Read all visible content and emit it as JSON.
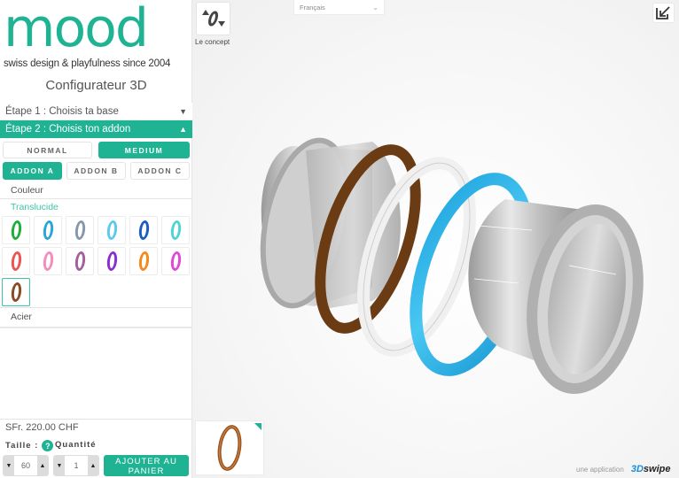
{
  "brand": {
    "logo_text": "mood",
    "tagline": "swiss design & playfulness since 2004",
    "title": "Configurateur 3D",
    "accent_color": "#1fb393"
  },
  "steps": [
    {
      "label": "Étape 1 : Choisis ta base",
      "icon": "chevron-down-icon",
      "expanded": false
    },
    {
      "label": "Étape 2 : Choisis ton addon",
      "icon": "chevron-up-icon",
      "expanded": true
    }
  ],
  "width_options": [
    {
      "label": "NORMAL",
      "selected": false
    },
    {
      "label": "MEDIUM",
      "selected": true
    }
  ],
  "addon_tabs": [
    {
      "label": "ADDON A",
      "selected": true
    },
    {
      "label": "ADDON B",
      "selected": false
    },
    {
      "label": "ADDON C",
      "selected": false
    }
  ],
  "sections": {
    "color_label": "Couleur",
    "translucent_label": "Translucide",
    "steel_label": "Acier"
  },
  "swatches": [
    {
      "name": "green",
      "color": "#1cb03a",
      "selected": false
    },
    {
      "name": "sky-blue",
      "color": "#2aa6d6",
      "selected": false
    },
    {
      "name": "grey-blue",
      "color": "#8797ab",
      "selected": false
    },
    {
      "name": "light-blue",
      "color": "#5cc9ef",
      "selected": false
    },
    {
      "name": "dark-blue",
      "color": "#1a5fbf",
      "selected": false
    },
    {
      "name": "turquoise",
      "color": "#4fd3d3",
      "selected": false
    },
    {
      "name": "red",
      "color": "#f0524f",
      "selected": false
    },
    {
      "name": "pink",
      "color": "#f48cbe",
      "selected": false
    },
    {
      "name": "mauve",
      "color": "#a2609e",
      "selected": false
    },
    {
      "name": "purple",
      "color": "#8a2ed0",
      "selected": false
    },
    {
      "name": "orange",
      "color": "#f5891a",
      "selected": false
    },
    {
      "name": "magenta",
      "color": "#e04ad4",
      "selected": false
    },
    {
      "name": "brown",
      "color": "#8a4a22",
      "selected": true
    }
  ],
  "order": {
    "price": "SFr. 220.00 CHF",
    "size_label": "Taille :",
    "help_icon": "?",
    "quantity_label": "Quantité",
    "size_value": "60",
    "quantity_value": "1",
    "add_to_cart_line1": "AJOUTER AU",
    "add_to_cart_line2": "PANIER"
  },
  "viewer": {
    "concept_label": "Le concept",
    "language": "Français",
    "credit_prefix": "une application",
    "credit_brand_a": "3D",
    "credit_brand_b": "swipe",
    "ring_colors": {
      "steel": "#c9c9c9",
      "brown": "#6b3b14",
      "white": "#ececec",
      "blue": "#2ab4e8"
    }
  }
}
